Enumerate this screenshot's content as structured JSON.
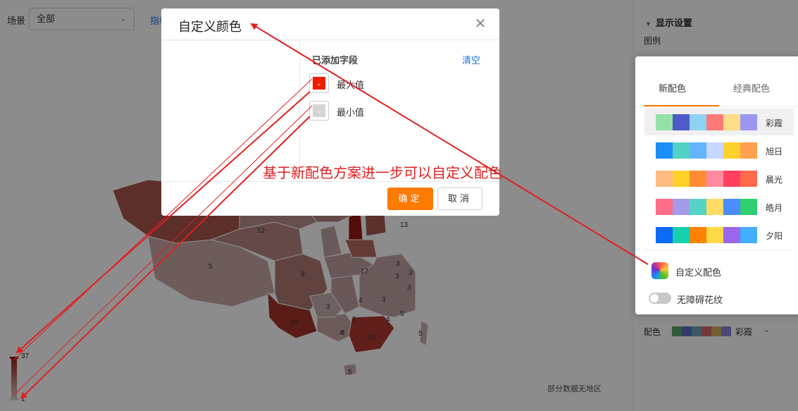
{
  "toolbar": {
    "scene_label": "场景",
    "scene_value": "全部",
    "metric_link": "指标"
  },
  "map": {
    "region_values": [
      "12",
      "13",
      "5",
      "9",
      "17",
      "3",
      "4",
      "3",
      "3",
      "3",
      "4",
      "3",
      "4",
      "5",
      "22",
      "4",
      "28",
      "5",
      "5",
      "3",
      "3"
    ],
    "legend_max": "37",
    "legend_min": "1",
    "no_data_text": "部分数据无地区"
  },
  "settings": {
    "section_title": "显示设置",
    "legend_label": "图例",
    "palette_label": "配色",
    "palette_name": "彩霞",
    "palette_colors": [
      "#5aa469",
      "#5b6cc0",
      "#6ca3b5",
      "#d46a6a",
      "#d4b05b",
      "#8a86d8"
    ]
  },
  "popover": {
    "tab_new": "新配色",
    "tab_classic": "经典配色",
    "schemes": [
      {
        "name": "彩霞",
        "colors": [
          "#94e1a8",
          "#5059c9",
          "#8fd3f4",
          "#ff7a76",
          "#ffdd87",
          "#9b97f0"
        ]
      },
      {
        "name": "旭日",
        "colors": [
          "#1b8ff7",
          "#52d1c4",
          "#64b5ff",
          "#c6d8ff",
          "#ffcf2c",
          "#ffa04d"
        ]
      },
      {
        "name": "晨光",
        "colors": [
          "#ffbb82",
          "#ffd028",
          "#ff8c32",
          "#ff8aa0",
          "#ff4060",
          "#ff6a4c"
        ]
      },
      {
        "name": "皓月",
        "colors": [
          "#ff6e86",
          "#a39ae8",
          "#56d3c6",
          "#ffdc64",
          "#4b8dff",
          "#2fce70"
        ]
      },
      {
        "name": "夕阳",
        "colors": [
          "#0f6bf7",
          "#16cfac",
          "#ff8200",
          "#ffd947",
          "#9a67ea",
          "#41aeff"
        ]
      }
    ],
    "custom_label": "自定义配色",
    "a11y_label": "无障碍花纹"
  },
  "modal": {
    "title": "自定义颜色",
    "fields_title": "已添加字段",
    "clear_label": "清空",
    "fields": [
      {
        "label": "最大值",
        "color": "#f01c00"
      },
      {
        "label": "最小值",
        "color": "#d6d3d3"
      }
    ],
    "ok_label": "确定",
    "cancel_label": "取消"
  },
  "annotation_text": "基于新配色方案进一步可以自定义配色",
  "colors": {
    "accent": "#ff7a00",
    "annotation": "#e02020",
    "link": "#1a73e8"
  }
}
